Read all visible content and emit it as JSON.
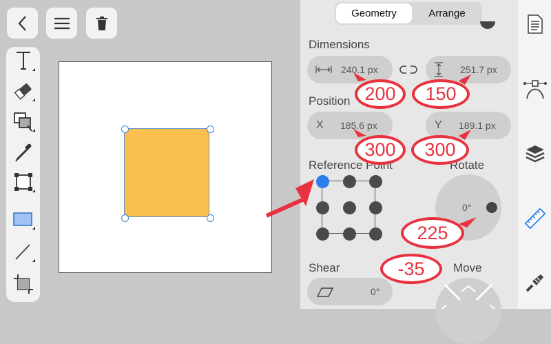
{
  "tabs": {
    "geometry": "Geometry",
    "arrange": "Arrange"
  },
  "dimensions": {
    "label": "Dimensions",
    "width_value": "240.1 px",
    "height_value": "251.7 px"
  },
  "position": {
    "label": "Position",
    "x_label": "X",
    "x_value": "185.6 px",
    "y_label": "Y",
    "y_value": "189.1 px"
  },
  "reference_point": {
    "label": "Reference Point"
  },
  "rotate": {
    "label": "Rotate",
    "value": "0°"
  },
  "shear": {
    "label": "Shear",
    "value": "0°"
  },
  "move": {
    "label": "Move"
  },
  "annotations": {
    "width": "200",
    "height": "150",
    "x": "300",
    "y": "300",
    "rotate": "225",
    "shear": "-35"
  },
  "colors": {
    "shape_fill": "#fbbf4d",
    "accent": "#2b7de9",
    "annotation_red": "#e8323f"
  },
  "icons": {
    "top": [
      "back-icon",
      "menu-icon",
      "trash-icon"
    ],
    "tools": [
      "text-tool-icon",
      "eraser-icon",
      "transform-icon",
      "eyedropper-icon",
      "crop-icon",
      "rectangle-tool-icon",
      "line-tool-icon",
      "artboard-icon"
    ],
    "right": [
      "document-icon",
      "bezier-icon",
      "layers-icon",
      "ruler-icon",
      "brush-icon"
    ]
  }
}
